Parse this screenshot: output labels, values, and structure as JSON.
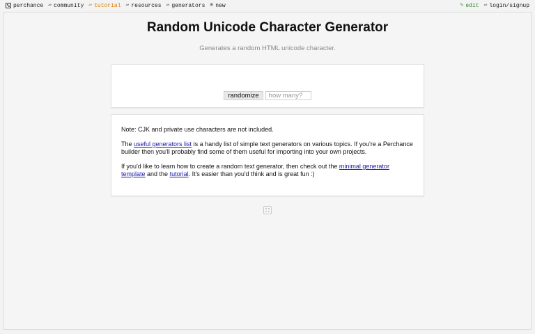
{
  "topbar": {
    "brand": "perchance",
    "community": "community",
    "tutorial": "tutorial",
    "resources": "resources",
    "generators": "generators",
    "new": "new",
    "edit": "edit",
    "login": "login/signup",
    "icons": {
      "brand": "dice-icon",
      "community": "people-icon",
      "tutorial": "book-icon",
      "resources": "folder-icon",
      "generators": "grid-icon",
      "new": "plus-circle-icon",
      "edit": "pencil-icon",
      "login": "user-icon"
    },
    "colors": {
      "tutorial": "#d97a00",
      "edit": "#2f8b2f"
    }
  },
  "header": {
    "title": "Random Unicode Character Generator",
    "subtitle": "Generates a random HTML unicode character."
  },
  "output": {
    "character": "",
    "randomize_label": "randomize",
    "count_placeholder": "how many?"
  },
  "info": {
    "note": "Note: CJK and private use characters are not included.",
    "p2_before": "The ",
    "p2_link": "useful generators list",
    "p2_after": " is a handy list of simple text generators on various topics. If you're a Perchance builder then you'll probably find some of them useful for importing into your own projects.",
    "p3_before": "If you'd like to learn how to create a random text generator, then check out the ",
    "p3_link1": "minimal generator template",
    "p3_mid": " and the ",
    "p3_link2": "tutorial",
    "p3_after": ". It's easier than you'd think and is great fun :)"
  },
  "footer": {
    "icon": "dice-icon"
  }
}
